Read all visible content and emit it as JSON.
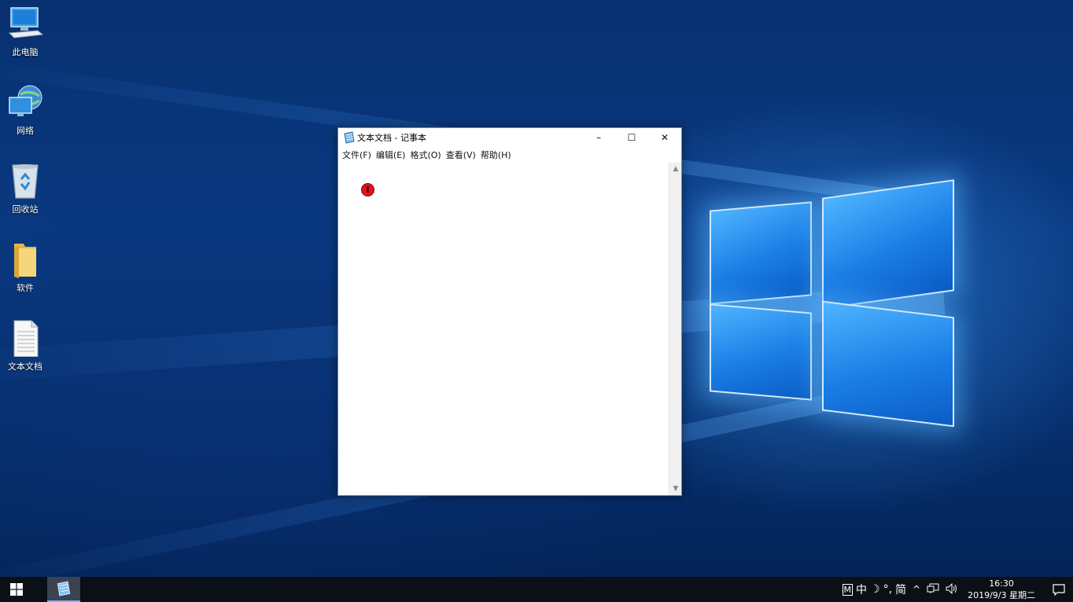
{
  "desktop": {
    "icons": [
      {
        "label": "此电脑",
        "icon": "computer-icon"
      },
      {
        "label": "网络",
        "icon": "network-icon"
      },
      {
        "label": "回收站",
        "icon": "recycle-bin-icon"
      },
      {
        "label": "软件",
        "icon": "folder-icon"
      },
      {
        "label": "文本文档",
        "icon": "text-document-icon"
      }
    ]
  },
  "notepad": {
    "title": "文本文档 - 记事本",
    "icon": "notepad-icon",
    "controls": {
      "minimize": "–",
      "maximize": "☐",
      "close": "✕"
    },
    "menu": [
      "文件(F)",
      "编辑(E)",
      "格式(O)",
      "查看(V)",
      "帮助(H)"
    ],
    "content": "",
    "cursor_glyph": "I"
  },
  "taskbar": {
    "start_icon": "windows-start-icon",
    "pinned_app_icon": "notepad-icon",
    "ime": {
      "m": "M",
      "lang": "中",
      "moon": "☽",
      "punct": "°,",
      "mode": "简"
    },
    "tray_chevron": "^",
    "network_icon": "network-tray-icon",
    "volume_icon": "volume-icon",
    "time": "16:30",
    "date": "2019/9/3 星期二",
    "notification_icon": "action-center-icon"
  },
  "colors": {
    "wallpaper": "#073070",
    "window_border": "#5a8fcf",
    "taskbar": "#0b0f16",
    "cursor_highlight": "#e8121a"
  }
}
